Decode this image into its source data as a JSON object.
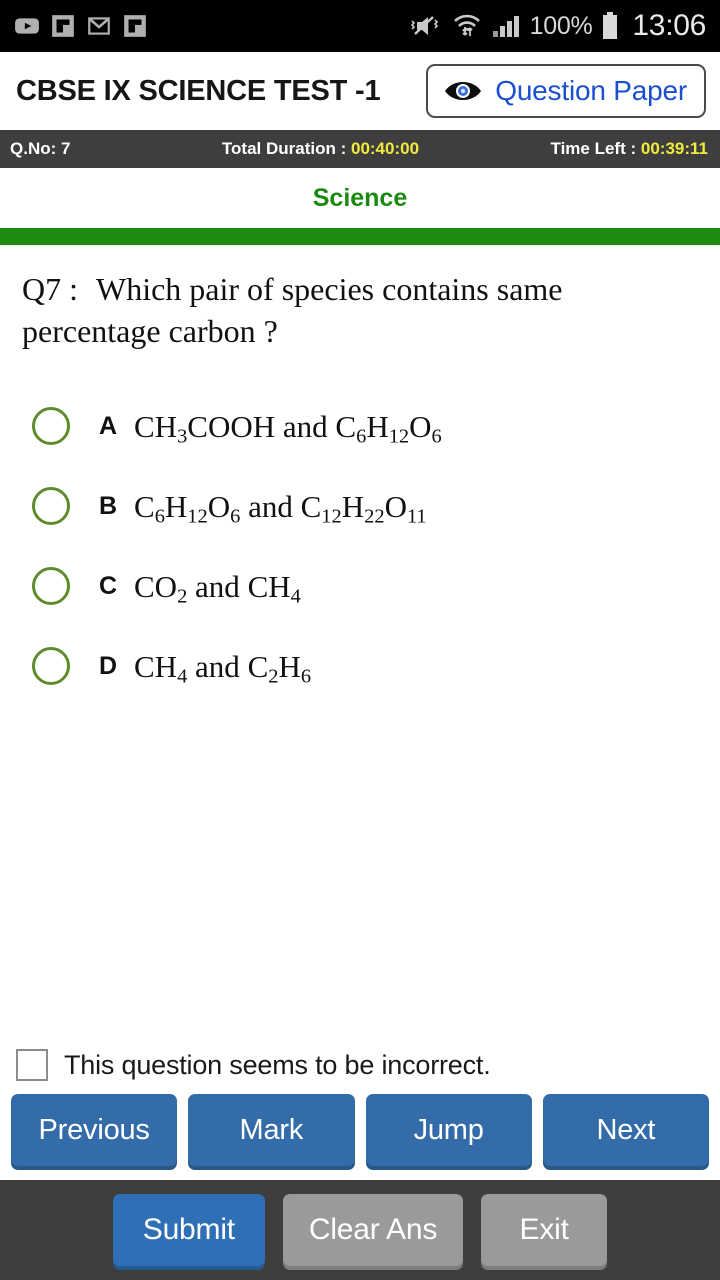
{
  "status_bar": {
    "notifications": [
      {
        "name": "youtube-icon"
      },
      {
        "name": "flipboard-icon"
      },
      {
        "name": "gmail-icon"
      },
      {
        "name": "flipboard-icon-2"
      }
    ],
    "mute_icon": "volume-mute-vibrate-icon",
    "wifi_icon": "wifi-transfer-icon",
    "signal_icon": "cellular-signal-icon",
    "battery_percent": "100%",
    "battery_icon": "battery-full-icon",
    "clock": "13:06"
  },
  "header": {
    "test_title": "CBSE IX SCIENCE TEST -1",
    "question_paper_button": "Question Paper",
    "eye_icon": "eye-icon"
  },
  "timer_bar": {
    "qno_label": "Q.No: ",
    "qno_value": "7",
    "duration_label": "Total Duration : ",
    "duration_value": "00:40:00",
    "time_left_label": "Time Left : ",
    "time_left_value": "00:39:11"
  },
  "subject": {
    "name": "Science"
  },
  "question": {
    "number": "Q7 :",
    "text": "Which pair of species contains same percentage carbon ?",
    "options": [
      {
        "letter": "A",
        "selected": false,
        "text_plain": "CH3COOH and C6H12O6",
        "parts": [
          {
            "t": "CH"
          },
          {
            "t": "3",
            "sub": true
          },
          {
            "t": "COOH"
          },
          {
            "t": " and "
          },
          {
            "t": "C"
          },
          {
            "t": "6",
            "sub": true
          },
          {
            "t": "H"
          },
          {
            "t": "12",
            "sub": true
          },
          {
            "t": "O"
          },
          {
            "t": "6",
            "sub": true
          }
        ]
      },
      {
        "letter": "B",
        "selected": false,
        "text_plain": "C6H12O6 and C12H22O11",
        "parts": [
          {
            "t": "C"
          },
          {
            "t": "6",
            "sub": true
          },
          {
            "t": "H"
          },
          {
            "t": "12",
            "sub": true
          },
          {
            "t": "O"
          },
          {
            "t": "6",
            "sub": true
          },
          {
            "t": "  and "
          },
          {
            "t": "C"
          },
          {
            "t": "12",
            "sub": true
          },
          {
            "t": "H"
          },
          {
            "t": "22",
            "sub": true
          },
          {
            "t": "O"
          },
          {
            "t": "11",
            "sub": true
          }
        ]
      },
      {
        "letter": "C",
        "selected": false,
        "text_plain": "CO2 and CH4",
        "parts": [
          {
            "t": "CO"
          },
          {
            "t": "2",
            "sub": true
          },
          {
            "t": "  and "
          },
          {
            "t": "CH"
          },
          {
            "t": "4",
            "sub": true
          }
        ]
      },
      {
        "letter": "D",
        "selected": false,
        "text_plain": "CH4 and C2H6",
        "parts": [
          {
            "t": "CH"
          },
          {
            "t": "4",
            "sub": true
          },
          {
            "t": "  and "
          },
          {
            "t": "C"
          },
          {
            "t": "2",
            "sub": true
          },
          {
            "t": "H"
          },
          {
            "t": "6",
            "sub": true
          }
        ]
      }
    ]
  },
  "flag": {
    "checked": false,
    "label": "This question seems to be incorrect."
  },
  "nav_buttons": [
    {
      "label": "Previous",
      "name": "previous-button"
    },
    {
      "label": "Mark",
      "name": "mark-button"
    },
    {
      "label": "Jump",
      "name": "jump-button"
    },
    {
      "label": "Next",
      "name": "next-button"
    }
  ],
  "footer_buttons": [
    {
      "label": "Submit",
      "name": "submit-button",
      "style": "primary"
    },
    {
      "label": "Clear Ans",
      "name": "clear-answer-button",
      "style": "secondary"
    },
    {
      "label": "Exit",
      "name": "exit-button",
      "style": "secondary"
    }
  ],
  "colors": {
    "accent_green": "#1e8c10",
    "radio_green": "#5f8b2c",
    "primary_blue": "#336ca9",
    "link_blue": "#1a4fd0",
    "timer_value_yellow": "#f2ea3c",
    "bar_dark": "#3e3e3e"
  }
}
